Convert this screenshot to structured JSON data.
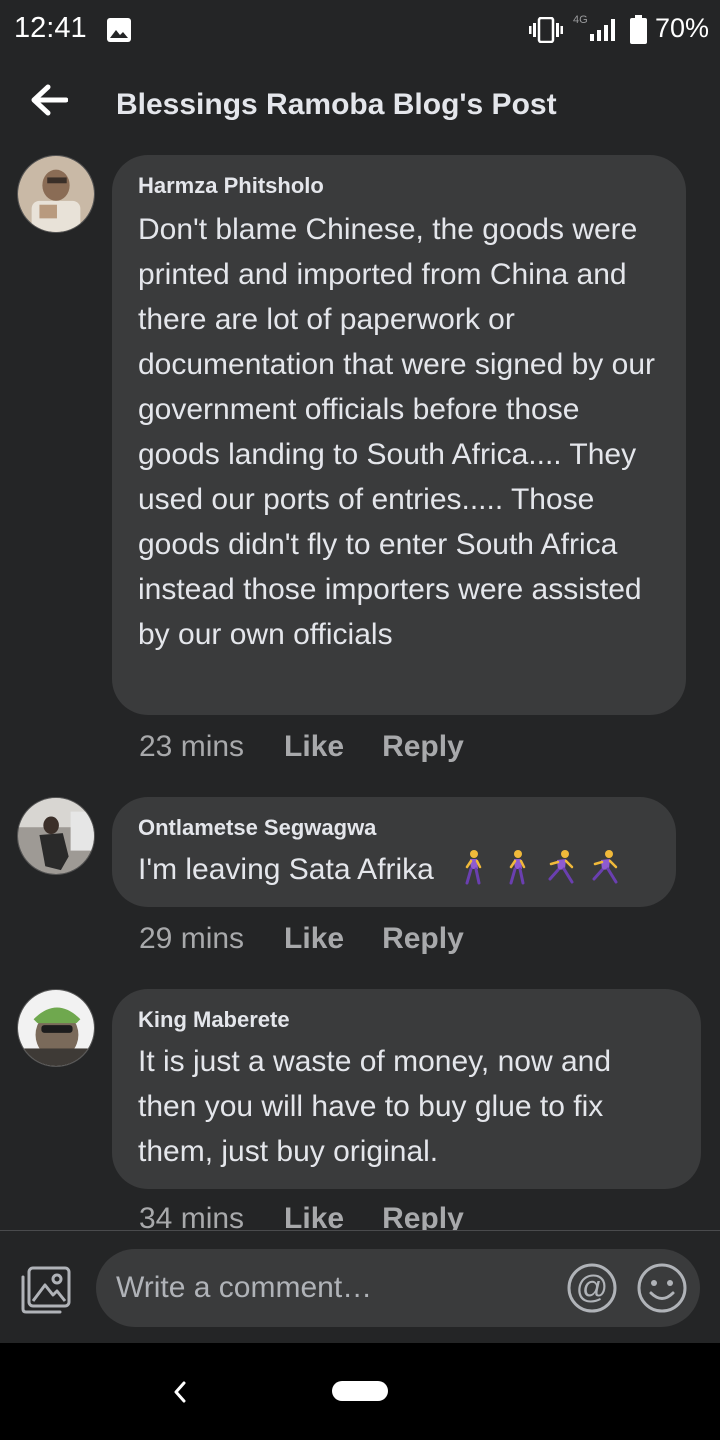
{
  "status_bar": {
    "time": "12:41",
    "network": "4G",
    "battery": "70%",
    "icons": [
      "gallery-icon",
      "vibrate-icon",
      "signal-icon",
      "battery-icon"
    ]
  },
  "header": {
    "title": "Blessings Ramoba Blog's Post",
    "back_icon": "back-arrow-icon"
  },
  "comments": [
    {
      "author": "Harmza Phitsholo",
      "text": "Don't blame Chinese, the goods were printed and imported from China and there are lot of paperwork or documentation that were signed by our government officials before those goods landing to South Africa.... They used our ports of entries..... Those goods didn't fly to enter South Africa instead those importers were assisted by our own officials",
      "time": "23 mins",
      "like": "Like",
      "reply": "Reply"
    },
    {
      "author": "Ontlametse Segwagwa",
      "text": "I'm leaving Sata Afrika",
      "emojis": [
        "woman-walking",
        "woman-walking",
        "woman-running",
        "woman-running"
      ],
      "time": "29 mins",
      "like": "Like",
      "reply": "Reply"
    },
    {
      "author": "King Maberete",
      "text": "It is just a waste of money, now and then you will have to buy glue to fix them, just buy original.",
      "time": "34 mins",
      "like": "Like",
      "reply": "Reply"
    }
  ],
  "composer": {
    "placeholder": "Write a comment…",
    "icons": [
      "photo-icon",
      "at-icon",
      "smile-icon"
    ]
  },
  "colors": {
    "background": "#242526",
    "bubble": "#3a3b3c",
    "text": "#e4e6eb",
    "muted": "#a8a9ab"
  }
}
